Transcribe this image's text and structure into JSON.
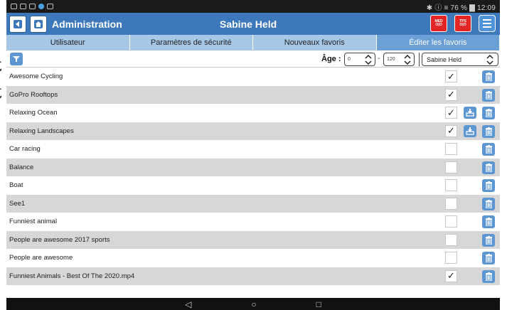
{
  "status_bar": {
    "right": "✱ ⓘ ≡ 76 % ▇ 12:09"
  },
  "app_bar": {
    "title": "Administration",
    "user": "Sabine Held",
    "badge_med": "MED\nO|O",
    "badge_tps": "TPS\nO|O"
  },
  "tabs": [
    {
      "label": "Utilisateur",
      "active": false
    },
    {
      "label": "Paramètres de sécurité",
      "active": false
    },
    {
      "label": "Nouveaux favoris",
      "active": false
    },
    {
      "label": "Éditer les favoris",
      "active": true
    }
  ],
  "filter": {
    "age_label": "Âge :",
    "age_min": "0",
    "age_max": "120",
    "dash": "-",
    "user_select": "Sabine Held"
  },
  "favorites": [
    {
      "name": "Awesome Cycling",
      "checked": true,
      "downloadable": false
    },
    {
      "name": "GoPro Rooftops",
      "checked": true,
      "downloadable": false
    },
    {
      "name": "Relaxing Ocean",
      "checked": true,
      "downloadable": true
    },
    {
      "name": "Relaxing Landscapes",
      "checked": true,
      "downloadable": true
    },
    {
      "name": "Car racing",
      "checked": false,
      "downloadable": false
    },
    {
      "name": "Balance",
      "checked": false,
      "downloadable": false
    },
    {
      "name": "Boat",
      "checked": false,
      "downloadable": false
    },
    {
      "name": "See1",
      "checked": false,
      "downloadable": false
    },
    {
      "name": "Funniest animal",
      "checked": false,
      "downloadable": false
    },
    {
      "name": "People are awesome 2017 sports",
      "checked": false,
      "downloadable": false
    },
    {
      "name": "People are awesome",
      "checked": false,
      "downloadable": false
    },
    {
      "name": "Funniest Animals - Best Of The 2020.mp4",
      "checked": true,
      "downloadable": false
    }
  ],
  "checkmark": "✓",
  "nav": {
    "back": "◁",
    "home": "○",
    "recent": "□"
  },
  "icons": {
    "back": "back-arrow-icon",
    "home": "home-icon",
    "filter": "filter-funnel-icon",
    "download": "download-icon",
    "delete": "trash-icon",
    "menu": "hamburger-menu-icon"
  },
  "colors": {
    "app_bar": "#3d79ba",
    "tab_bg": "#a7c7e7",
    "tab_active": "#6aa0d6",
    "row_alt": "#d7d7d7",
    "icon_btn": "#5d97d2",
    "badge": "#e32525"
  }
}
